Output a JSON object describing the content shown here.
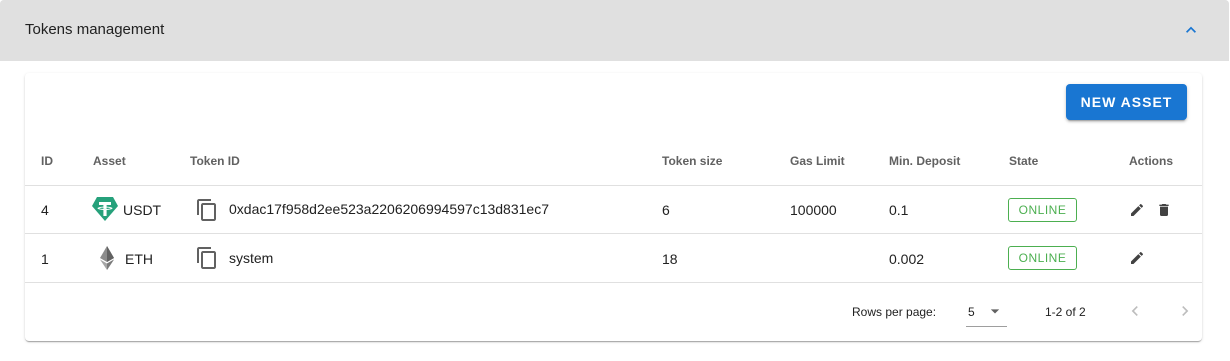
{
  "accordion": {
    "title": "Tokens management",
    "expand_icon": "chevron-up-icon"
  },
  "toolbar": {
    "new_asset_label": "NEW ASSET"
  },
  "colors": {
    "primary": "#1976d2",
    "online": "#4caf50",
    "tether": "#26a17b",
    "eth": "#8c8c8c"
  },
  "table": {
    "headers": {
      "id": "ID",
      "asset": "Asset",
      "token_id": "Token ID",
      "token_size": "Token size",
      "gas_limit": "Gas Limit",
      "min_deposit": "Min. Deposit",
      "state": "State",
      "actions": "Actions"
    },
    "rows": [
      {
        "id": "4",
        "asset": "USDT",
        "asset_icon": "tether-icon",
        "token_id": "0xdac17f958d2ee523a2206206994597c13d831ec7",
        "token_size": "6",
        "gas_limit": "100000",
        "min_deposit": "0.1",
        "state": "ONLINE",
        "actions": [
          "edit-icon",
          "delete-icon"
        ]
      },
      {
        "id": "1",
        "asset": "ETH",
        "asset_icon": "ethereum-icon",
        "token_id": "system",
        "token_size": "18",
        "gas_limit": "",
        "min_deposit": "0.002",
        "state": "ONLINE",
        "actions": [
          "edit-icon"
        ]
      }
    ]
  },
  "pagination": {
    "rows_per_page_label": "Rows per page:",
    "rows_per_page_value": "5",
    "range": "1-2 of 2"
  }
}
